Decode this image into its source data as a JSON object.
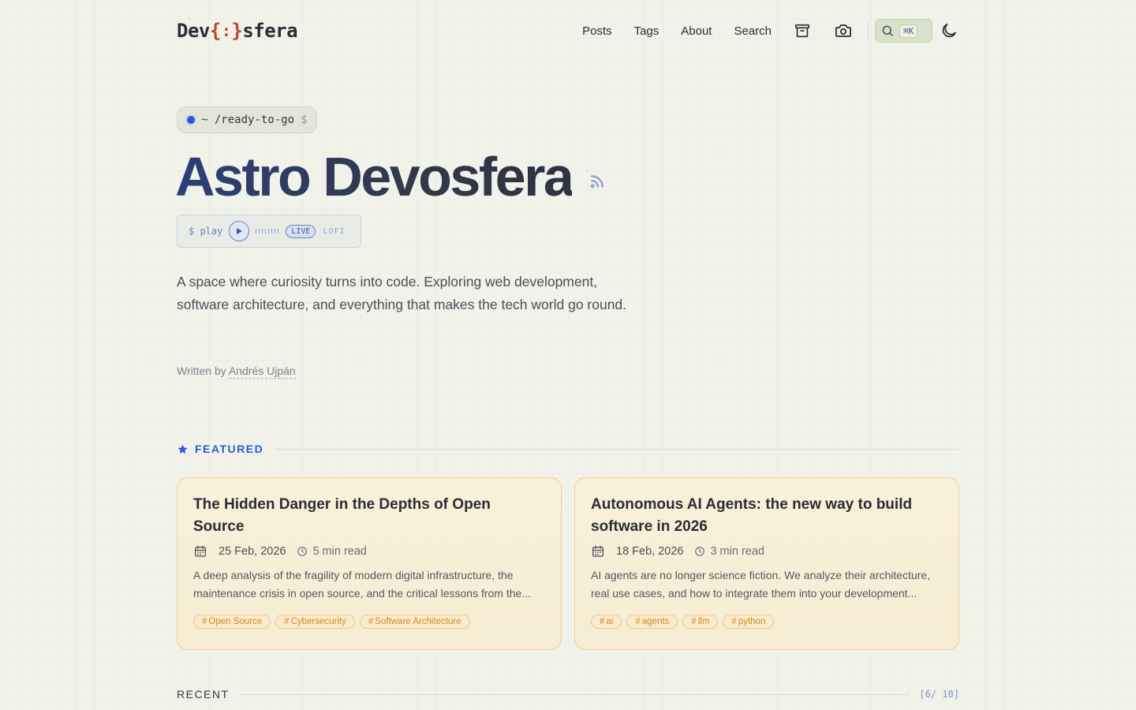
{
  "header": {
    "logo": {
      "left": "Dev",
      "brace_open": "{",
      "dots": ":",
      "brace_close": "}",
      "right": "sfera"
    },
    "nav": [
      "Posts",
      "Tags",
      "About",
      "Search"
    ],
    "icons": [
      "archive-icon",
      "camera-icon",
      "search-icon",
      "moon-icon"
    ],
    "search_shortcut": "⌘K"
  },
  "hero": {
    "prompt": {
      "tilde": "~",
      "path": "/ready-to-go",
      "dollar": "$"
    },
    "title": "Astro Devosfera",
    "player": {
      "label": "$ play",
      "live": "LIVE",
      "genre": "LOFI"
    },
    "description": "A space where curiosity turns into code. Exploring web development, software architecture, and everything that makes the tech world go round.",
    "byline_prefix": "Written by",
    "author": "Andrés Ujpán"
  },
  "featured": {
    "label": "FEATURED",
    "posts": [
      {
        "title": "The Hidden Danger in the Depths of Open Source",
        "date": "25 Feb, 2026",
        "read_time": "5 min read",
        "excerpt": "A deep analysis of the fragility of modern digital infrastructure, the maintenance crisis in open source, and the critical lessons from the...",
        "tags": [
          "Open Source",
          "Cybersecurity",
          "Software Architecture"
        ]
      },
      {
        "title": "Autonomous AI Agents: the new way to build software in 2026",
        "date": "18 Feb, 2026",
        "read_time": "3 min read",
        "excerpt": "AI agents are no longer science fiction. We analyze their architecture, real use cases, and how to integrate them into your development...",
        "tags": [
          "ai",
          "agents",
          "llm",
          "python"
        ]
      }
    ]
  },
  "recent": {
    "label": "RECENT",
    "count": "[6/ 10]"
  },
  "colors": {
    "accent_blue": "#2a5bd7",
    "accent_amber": "#d08a1a",
    "logo_brace": "#c0452c"
  }
}
